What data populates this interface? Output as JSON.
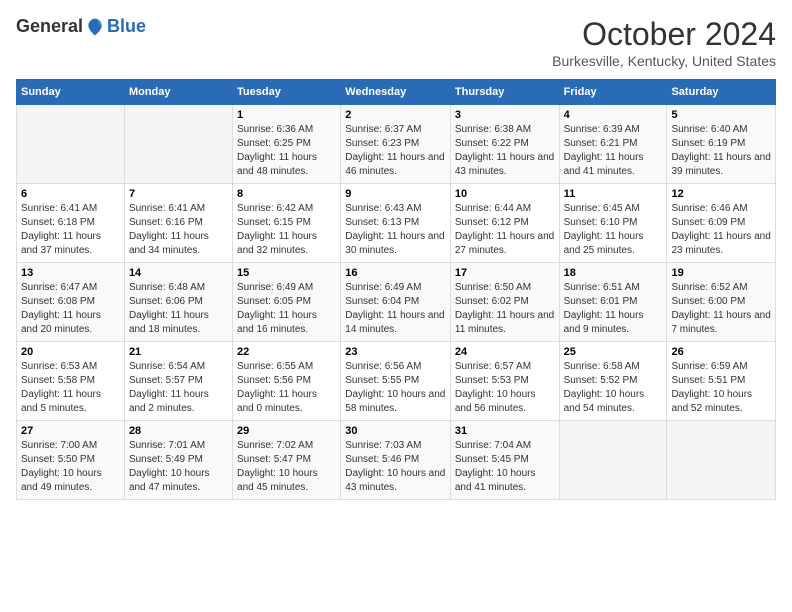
{
  "logo": {
    "general": "General",
    "blue": "Blue"
  },
  "header": {
    "month": "October 2024",
    "location": "Burkesville, Kentucky, United States"
  },
  "weekdays": [
    "Sunday",
    "Monday",
    "Tuesday",
    "Wednesday",
    "Thursday",
    "Friday",
    "Saturday"
  ],
  "weeks": [
    [
      {
        "day": "",
        "empty": true
      },
      {
        "day": "",
        "empty": true
      },
      {
        "day": "1",
        "sunrise": "Sunrise: 6:36 AM",
        "sunset": "Sunset: 6:25 PM",
        "daylight": "Daylight: 11 hours and 48 minutes."
      },
      {
        "day": "2",
        "sunrise": "Sunrise: 6:37 AM",
        "sunset": "Sunset: 6:23 PM",
        "daylight": "Daylight: 11 hours and 46 minutes."
      },
      {
        "day": "3",
        "sunrise": "Sunrise: 6:38 AM",
        "sunset": "Sunset: 6:22 PM",
        "daylight": "Daylight: 11 hours and 43 minutes."
      },
      {
        "day": "4",
        "sunrise": "Sunrise: 6:39 AM",
        "sunset": "Sunset: 6:21 PM",
        "daylight": "Daylight: 11 hours and 41 minutes."
      },
      {
        "day": "5",
        "sunrise": "Sunrise: 6:40 AM",
        "sunset": "Sunset: 6:19 PM",
        "daylight": "Daylight: 11 hours and 39 minutes."
      }
    ],
    [
      {
        "day": "6",
        "sunrise": "Sunrise: 6:41 AM",
        "sunset": "Sunset: 6:18 PM",
        "daylight": "Daylight: 11 hours and 37 minutes."
      },
      {
        "day": "7",
        "sunrise": "Sunrise: 6:41 AM",
        "sunset": "Sunset: 6:16 PM",
        "daylight": "Daylight: 11 hours and 34 minutes."
      },
      {
        "day": "8",
        "sunrise": "Sunrise: 6:42 AM",
        "sunset": "Sunset: 6:15 PM",
        "daylight": "Daylight: 11 hours and 32 minutes."
      },
      {
        "day": "9",
        "sunrise": "Sunrise: 6:43 AM",
        "sunset": "Sunset: 6:13 PM",
        "daylight": "Daylight: 11 hours and 30 minutes."
      },
      {
        "day": "10",
        "sunrise": "Sunrise: 6:44 AM",
        "sunset": "Sunset: 6:12 PM",
        "daylight": "Daylight: 11 hours and 27 minutes."
      },
      {
        "day": "11",
        "sunrise": "Sunrise: 6:45 AM",
        "sunset": "Sunset: 6:10 PM",
        "daylight": "Daylight: 11 hours and 25 minutes."
      },
      {
        "day": "12",
        "sunrise": "Sunrise: 6:46 AM",
        "sunset": "Sunset: 6:09 PM",
        "daylight": "Daylight: 11 hours and 23 minutes."
      }
    ],
    [
      {
        "day": "13",
        "sunrise": "Sunrise: 6:47 AM",
        "sunset": "Sunset: 6:08 PM",
        "daylight": "Daylight: 11 hours and 20 minutes."
      },
      {
        "day": "14",
        "sunrise": "Sunrise: 6:48 AM",
        "sunset": "Sunset: 6:06 PM",
        "daylight": "Daylight: 11 hours and 18 minutes."
      },
      {
        "day": "15",
        "sunrise": "Sunrise: 6:49 AM",
        "sunset": "Sunset: 6:05 PM",
        "daylight": "Daylight: 11 hours and 16 minutes."
      },
      {
        "day": "16",
        "sunrise": "Sunrise: 6:49 AM",
        "sunset": "Sunset: 6:04 PM",
        "daylight": "Daylight: 11 hours and 14 minutes."
      },
      {
        "day": "17",
        "sunrise": "Sunrise: 6:50 AM",
        "sunset": "Sunset: 6:02 PM",
        "daylight": "Daylight: 11 hours and 11 minutes."
      },
      {
        "day": "18",
        "sunrise": "Sunrise: 6:51 AM",
        "sunset": "Sunset: 6:01 PM",
        "daylight": "Daylight: 11 hours and 9 minutes."
      },
      {
        "day": "19",
        "sunrise": "Sunrise: 6:52 AM",
        "sunset": "Sunset: 6:00 PM",
        "daylight": "Daylight: 11 hours and 7 minutes."
      }
    ],
    [
      {
        "day": "20",
        "sunrise": "Sunrise: 6:53 AM",
        "sunset": "Sunset: 5:58 PM",
        "daylight": "Daylight: 11 hours and 5 minutes."
      },
      {
        "day": "21",
        "sunrise": "Sunrise: 6:54 AM",
        "sunset": "Sunset: 5:57 PM",
        "daylight": "Daylight: 11 hours and 2 minutes."
      },
      {
        "day": "22",
        "sunrise": "Sunrise: 6:55 AM",
        "sunset": "Sunset: 5:56 PM",
        "daylight": "Daylight: 11 hours and 0 minutes."
      },
      {
        "day": "23",
        "sunrise": "Sunrise: 6:56 AM",
        "sunset": "Sunset: 5:55 PM",
        "daylight": "Daylight: 10 hours and 58 minutes."
      },
      {
        "day": "24",
        "sunrise": "Sunrise: 6:57 AM",
        "sunset": "Sunset: 5:53 PM",
        "daylight": "Daylight: 10 hours and 56 minutes."
      },
      {
        "day": "25",
        "sunrise": "Sunrise: 6:58 AM",
        "sunset": "Sunset: 5:52 PM",
        "daylight": "Daylight: 10 hours and 54 minutes."
      },
      {
        "day": "26",
        "sunrise": "Sunrise: 6:59 AM",
        "sunset": "Sunset: 5:51 PM",
        "daylight": "Daylight: 10 hours and 52 minutes."
      }
    ],
    [
      {
        "day": "27",
        "sunrise": "Sunrise: 7:00 AM",
        "sunset": "Sunset: 5:50 PM",
        "daylight": "Daylight: 10 hours and 49 minutes."
      },
      {
        "day": "28",
        "sunrise": "Sunrise: 7:01 AM",
        "sunset": "Sunset: 5:49 PM",
        "daylight": "Daylight: 10 hours and 47 minutes."
      },
      {
        "day": "29",
        "sunrise": "Sunrise: 7:02 AM",
        "sunset": "Sunset: 5:47 PM",
        "daylight": "Daylight: 10 hours and 45 minutes."
      },
      {
        "day": "30",
        "sunrise": "Sunrise: 7:03 AM",
        "sunset": "Sunset: 5:46 PM",
        "daylight": "Daylight: 10 hours and 43 minutes."
      },
      {
        "day": "31",
        "sunrise": "Sunrise: 7:04 AM",
        "sunset": "Sunset: 5:45 PM",
        "daylight": "Daylight: 10 hours and 41 minutes."
      },
      {
        "day": "",
        "empty": true
      },
      {
        "day": "",
        "empty": true
      }
    ]
  ]
}
